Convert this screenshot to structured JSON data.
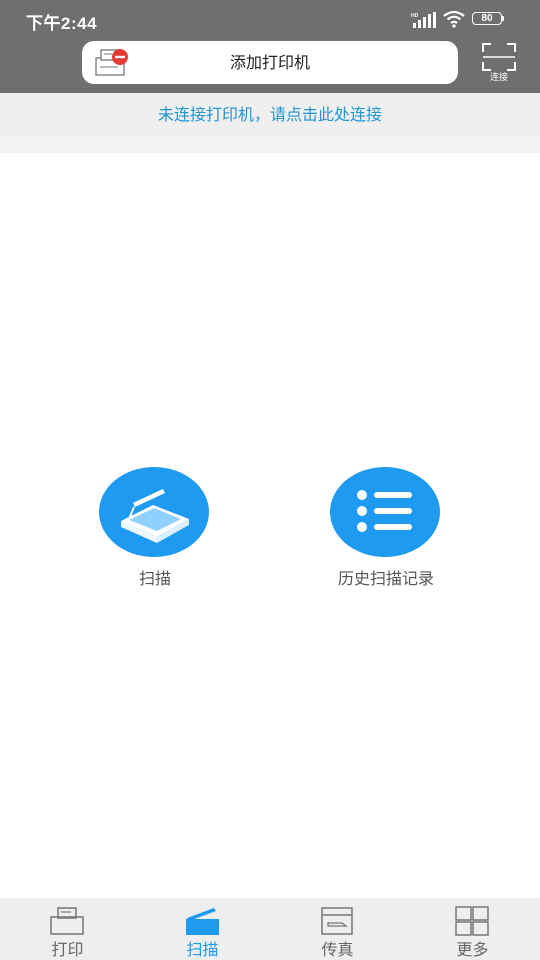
{
  "status_bar": {
    "time": "下午2:44",
    "network": "HD",
    "battery": "80",
    "icons": [
      "signal-icon",
      "wifi-icon",
      "battery-icon"
    ]
  },
  "header": {
    "add_printer_label": "添加打印机",
    "printer_icon": "printer-disconnected-icon",
    "scan_connect_label": "连接",
    "scan_icon": "qr-scan-icon"
  },
  "banner": {
    "text": "未连接打印机，请点击此处连接"
  },
  "main": {
    "features": [
      {
        "label": "扫描",
        "icon": "scanner-icon"
      },
      {
        "label": "历史扫描记录",
        "icon": "list-icon"
      }
    ]
  },
  "tabbar": {
    "tabs": [
      {
        "label": "打印",
        "icon": "printer-icon",
        "active": false
      },
      {
        "label": "扫描",
        "icon": "scanner-icon",
        "active": true
      },
      {
        "label": "传真",
        "icon": "fax-icon",
        "active": false
      },
      {
        "label": "更多",
        "icon": "grid-icon",
        "active": false
      }
    ]
  },
  "colors": {
    "header_bg": "#6f6f6f",
    "accent": "#1e9bf0",
    "banner_text": "#2196d3",
    "banner_bg": "#efefef",
    "tabbar_bg": "#eeeeee"
  }
}
